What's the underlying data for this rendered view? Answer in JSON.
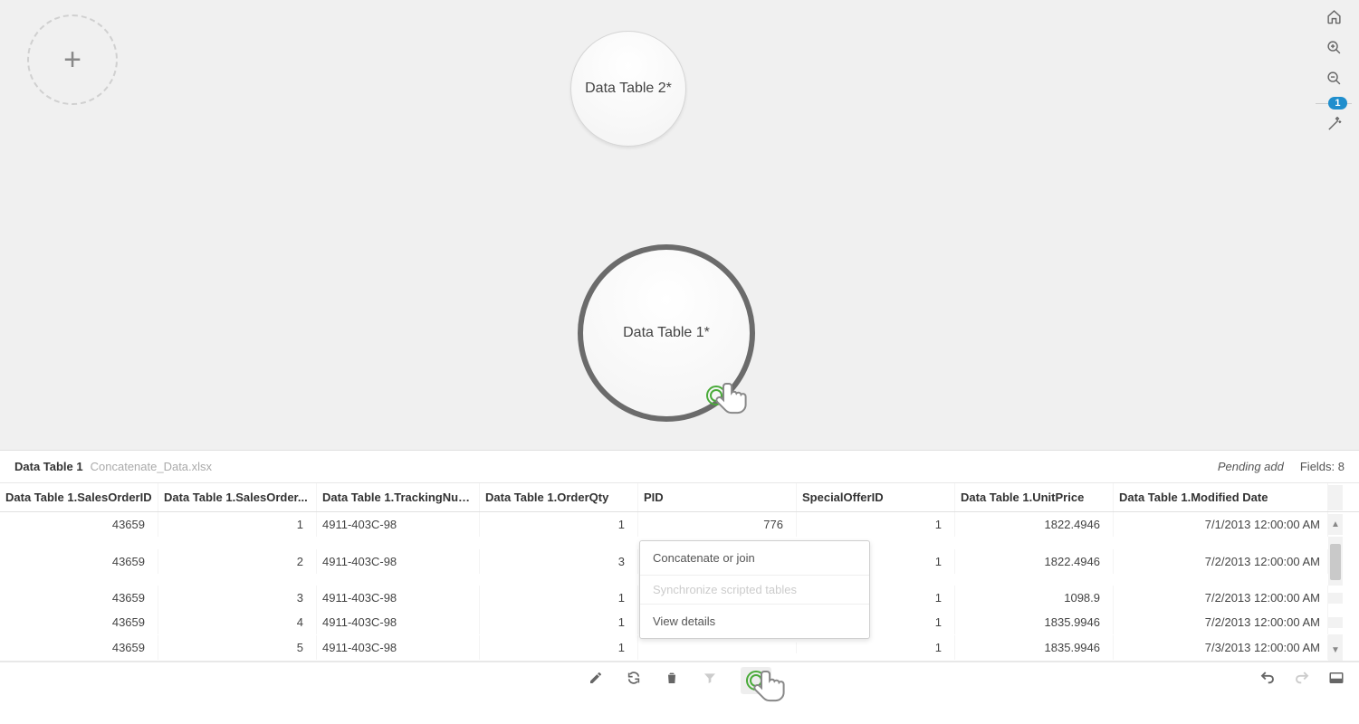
{
  "canvas": {
    "add_tooltip": "+",
    "node2_label": "Data Table 2*",
    "node1_label": "Data Table 1*"
  },
  "right_toolbar": {
    "badge": "1"
  },
  "panel": {
    "table_name": "Data Table 1",
    "file_name": "Concatenate_Data.xlsx",
    "pending": "Pending add",
    "fields_label": "Fields: 8"
  },
  "columns": [
    "Data Table 1.SalesOrderID",
    "Data Table 1.SalesOrder...",
    "Data Table 1.TrackingNum...",
    "Data Table 1.OrderQty",
    "PID",
    "SpecialOfferID",
    "Data Table 1.UnitPrice",
    "Data Table 1.Modified Date"
  ],
  "rows": [
    {
      "c0": "43659",
      "c1": "1",
      "c2": "4911-403C-98",
      "c3": "1",
      "c4": "776",
      "c5": "1",
      "c6": "1822.4946",
      "c7": "7/1/2013 12:00:00 AM"
    },
    {
      "c0": "43659",
      "c1": "2",
      "c2": "4911-403C-98",
      "c3": "3",
      "c4": "",
      "c5": "1",
      "c6": "1822.4946",
      "c7": "7/2/2013 12:00:00 AM"
    },
    {
      "c0": "43659",
      "c1": "3",
      "c2": "4911-403C-98",
      "c3": "1",
      "c4": "",
      "c5": "1",
      "c6": "1098.9",
      "c7": "7/2/2013 12:00:00 AM"
    },
    {
      "c0": "43659",
      "c1": "4",
      "c2": "4911-403C-98",
      "c3": "1",
      "c4": "",
      "c5": "1",
      "c6": "1835.9946",
      "c7": "7/2/2013 12:00:00 AM"
    },
    {
      "c0": "43659",
      "c1": "5",
      "c2": "4911-403C-98",
      "c3": "1",
      "c4": "",
      "c5": "1",
      "c6": "1835.9946",
      "c7": "7/3/2013 12:00:00 AM"
    }
  ],
  "menu": {
    "concat": "Concatenate or join",
    "sync": "Synchronize scripted tables",
    "view": "View details"
  }
}
